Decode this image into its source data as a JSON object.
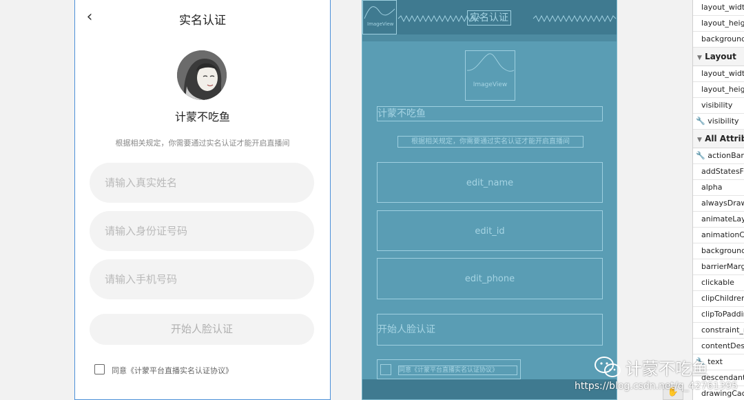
{
  "design": {
    "back_glyph": "‹",
    "title": "实名认证",
    "nickname": "计蒙不吃鱼",
    "hint": "根据相关规定，你需要通过实名认证才能开启直播间",
    "name_placeholder": "请输入真实姓名",
    "id_placeholder": "请输入身份证号码",
    "phone_placeholder": "请输入手机号码",
    "start_button": "开始人脸认证",
    "agreement": "同意《计蒙平台直播实名认证协议》",
    "agreement_checked": false
  },
  "blueprint": {
    "toolbar_image_label": "ImageView",
    "toolbar_title": "实名认证",
    "avatar_label": "ImageView",
    "nickname": "计蒙不吃鱼",
    "hint": "根据相关规定，你需要通过实名认证才能开启直播间",
    "edit_name": "edit_name",
    "edit_id": "edit_id",
    "edit_phone": "edit_phone",
    "start_button": "开始人脸认证",
    "agreement": "同意《计蒙平台直播实名认证协议》"
  },
  "attributes": {
    "top_rows": [
      "layout_width",
      "layout_height",
      "background"
    ],
    "layout_section": "Layout",
    "layout_rows": [
      "layout_width",
      "layout_height",
      "visibility"
    ],
    "layout_wrench_row": "visibility",
    "all_section": "All Attributes",
    "all_wrench_row": "actionBarNavMode",
    "all_rows": [
      "addStatesFromChildren",
      "alpha",
      "alwaysDrawnWithCache",
      "animateLayoutChanges",
      "animationCache",
      "background",
      "barrierMargin",
      "clickable",
      "clipChildren",
      "clipToPadding",
      "constraint_referenced_ids",
      "contentDescription"
    ],
    "wrench_text_row": "text",
    "after_rows": [
      "descendantFocusability",
      "drawingCacheQuality"
    ]
  },
  "watermark": {
    "brand": "计蒙不吃鱼",
    "url": "https://blog.csdn.net/q_42761395"
  },
  "colors": {
    "blueprint_bg": "#5a9db4",
    "blueprint_dark": "#3f7a90",
    "blueprint_line": "#9fd0e0",
    "selection_border": "#4a8fd8"
  }
}
